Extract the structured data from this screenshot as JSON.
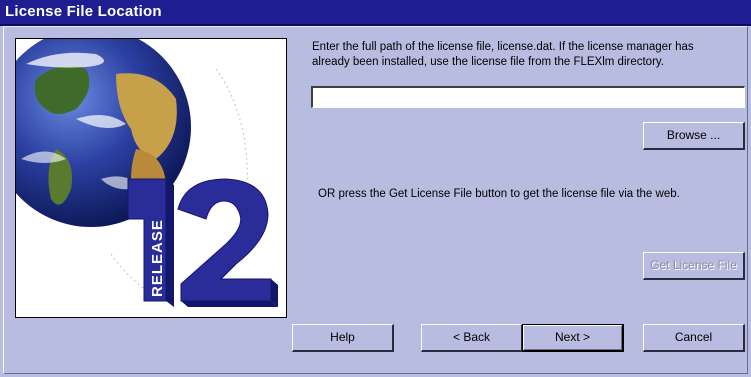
{
  "window": {
    "title": "License File Location"
  },
  "art": {
    "release_word": "RELEASE",
    "release_number": "12"
  },
  "main": {
    "instructions_line1": "Enter the full path of the license file, license.dat.  If the license manager has",
    "instructions_line2": "already been installed, use the license file from the FLEXlm directory.",
    "path_value": "",
    "browse_label": "Browse ...",
    "or_text": "OR press the Get License File button to get the license file via the web.",
    "get_license_label": "Get License File"
  },
  "buttons": {
    "help": "Help",
    "back": "< Back",
    "next": "Next >",
    "cancel": "Cancel"
  },
  "colors": {
    "title_bar": "#1e1e90",
    "dialog_bg": "#b8bce0",
    "logo_blue": "#2a2c9a"
  }
}
